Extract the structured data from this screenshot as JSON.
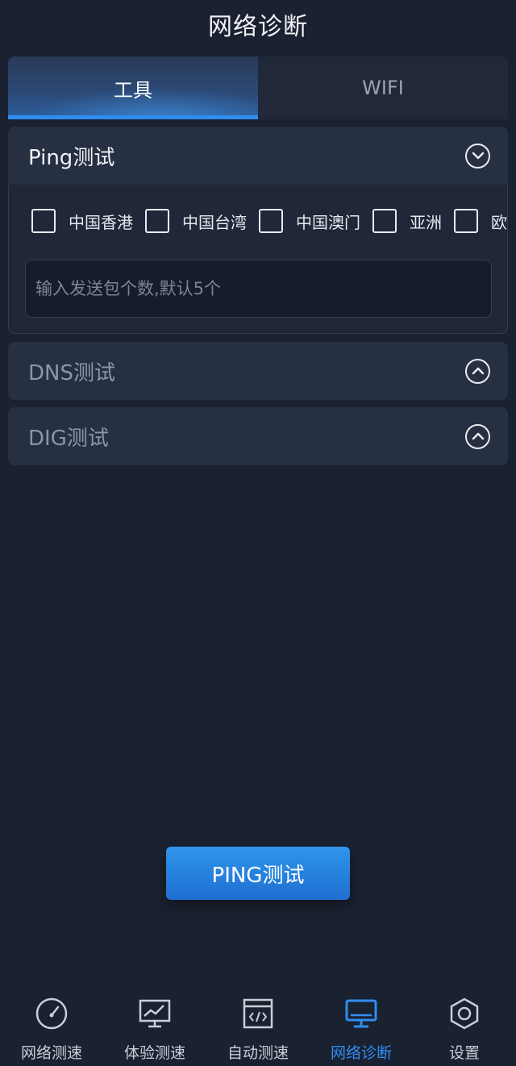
{
  "header": {
    "title": "网络诊断"
  },
  "tabs": [
    {
      "label": "工具",
      "active": true
    },
    {
      "label": "WIFI",
      "active": false
    }
  ],
  "ping_panel": {
    "title": "Ping测试",
    "icon": "chevron-down-circle-icon",
    "regions": [
      "中国香港",
      "中国台湾",
      "中国澳门",
      "亚洲",
      "欧洲"
    ],
    "count_input": {
      "value": "",
      "placeholder": "输入发送包个数,默认5个"
    }
  },
  "dns_panel": {
    "title": "DNS测试",
    "icon": "chevron-up-circle-icon"
  },
  "dig_panel": {
    "title": "DIG测试",
    "icon": "chevron-up-circle-icon"
  },
  "action_button": {
    "label": "PING测试"
  },
  "bottom_nav": [
    {
      "label": "网络测速",
      "icon": "speedometer-icon",
      "active": false
    },
    {
      "label": "体验测速",
      "icon": "monitor-chart-icon",
      "active": false
    },
    {
      "label": "自动测速",
      "icon": "code-window-icon",
      "active": false
    },
    {
      "label": "网络诊断",
      "icon": "desktop-icon",
      "active": true
    },
    {
      "label": "设置",
      "icon": "hexagon-settings-icon",
      "active": false
    }
  ],
  "colors": {
    "background": "#1a2130",
    "panel": "#273042",
    "accent": "#2f8df0",
    "text": "#e6e9ef",
    "muted_text": "#8d96a6"
  }
}
